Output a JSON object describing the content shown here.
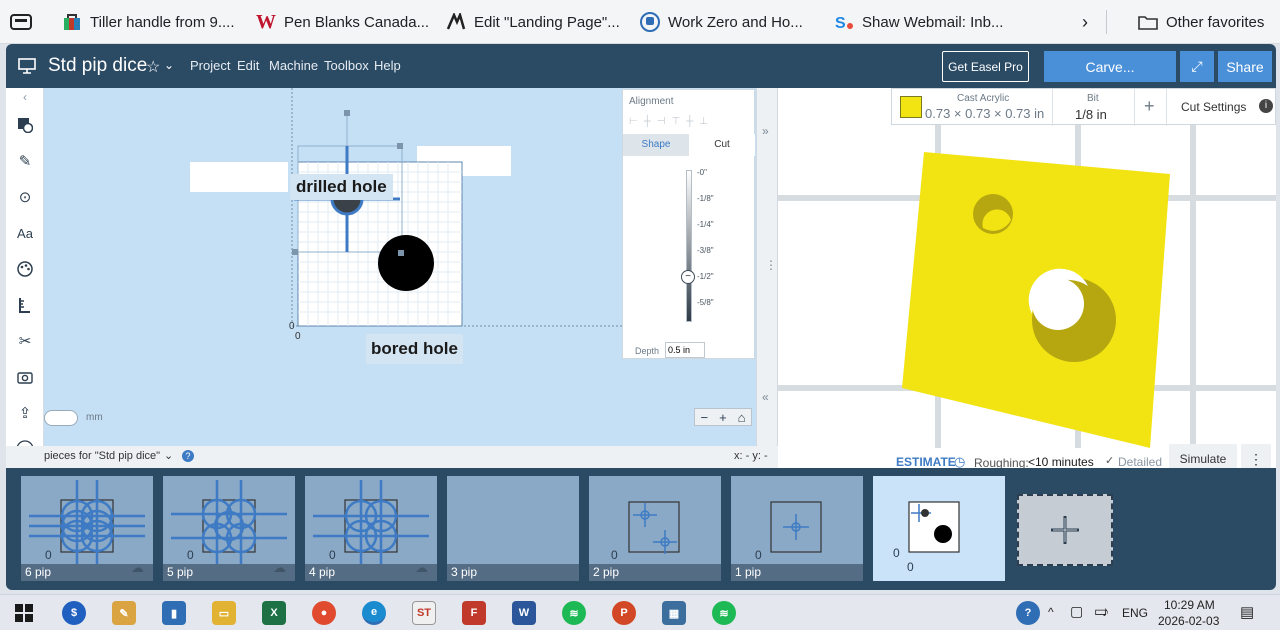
{
  "favorites": [
    {
      "label": "Tiller handle from 9....",
      "icon": "bag-icon",
      "color": "#c0392b"
    },
    {
      "label": "Pen Blanks Canada...",
      "icon": "w-logo-icon",
      "color": "#c0152f"
    },
    {
      "label": "Edit \"Landing Page\"...",
      "icon": "a-logo-icon",
      "color": "#222222"
    },
    {
      "label": "Work Zero and Ho...",
      "icon": "train-icon",
      "color": "#2f6db5"
    },
    {
      "label": "Shaw Webmail: Inb...",
      "icon": "shaw-logo-icon",
      "color": "#1e88e5"
    }
  ],
  "other_favorites": "Other favorites",
  "app": {
    "title": "Std pip dice",
    "menu": [
      "Project",
      "Edit",
      "Machine",
      "Toolbox",
      "Help"
    ],
    "get_pro": "Get Easel Pro",
    "carve": "Carve...",
    "share": "Share"
  },
  "canvas": {
    "drilled_label": "drilled hole",
    "bored_label": "bored hole",
    "origin_x": "0",
    "origin_y": "0",
    "unit_toggle": "mm",
    "pieces_for": "pieces for \"Std pip dice\"",
    "coords": "x: - y: -"
  },
  "cut_panel": {
    "alignment": "Alignment",
    "tab_shape": "Shape",
    "tab_cut": "Cut",
    "depth_ticks": [
      "-0\"",
      "-1/8\"",
      "-1/4\"",
      "-3/8\"",
      "-1/2\"",
      "-5/8\""
    ],
    "depth_label": "Depth",
    "depth_value": "0.5 in"
  },
  "material_bar": {
    "material": "Cast Acrylic",
    "dimensions": "0.73 × 0.73 × 0.73 in",
    "bit_label": "Bit",
    "bit_value": "1/8 in",
    "add": "+",
    "cut_settings": "Cut Settings",
    "material_color": "#f2e313"
  },
  "estimate": {
    "label": "ESTIMATE",
    "roughing_label": "Roughing:",
    "roughing_value": "<10 minutes",
    "detailed": "Detailed",
    "simulate": "Simulate"
  },
  "pieces": [
    {
      "label": "6 pip"
    },
    {
      "label": "5 pip"
    },
    {
      "label": "4 pip"
    },
    {
      "label": "3 pip"
    },
    {
      "label": "2 pip"
    },
    {
      "label": "1 pip"
    },
    {
      "label": ""
    }
  ],
  "piece_zero": "0",
  "taskbar": {
    "lang": "ENG",
    "time": "10:29 AM",
    "date": "2026-02-03"
  },
  "colors": {
    "header": "#2b4a64",
    "carve": "#4a90d9",
    "canvas": "#c5dff5",
    "accent": "#3e7bc4"
  }
}
